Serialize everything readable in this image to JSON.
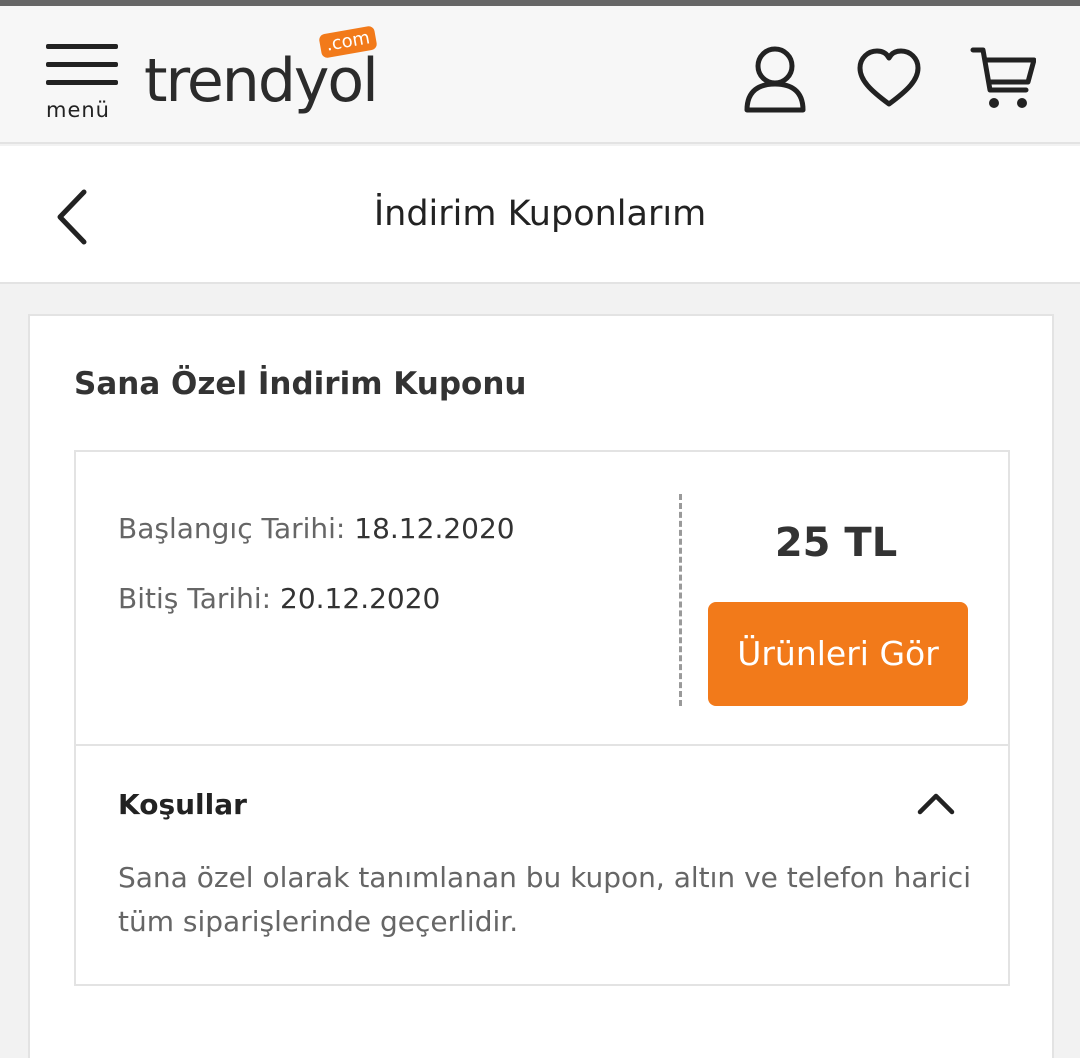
{
  "header": {
    "menu_label": "menü",
    "logo_word": "trendyol",
    "logo_badge": ".com",
    "brand_color": "#f27a1a",
    "icons": [
      "user-icon",
      "heart-icon",
      "cart-icon"
    ]
  },
  "titlebar": {
    "title": "İndirim Kuponlarım",
    "back_icon": "chevron-left-icon"
  },
  "coupon": {
    "heading": "Sana Özel İndirim Kuponu",
    "start_label": "Başlangıç Tarihi:",
    "start_value": "18.12.2020",
    "end_label": "Bitiş Tarihi:",
    "end_value": "20.12.2020",
    "amount": "25 TL",
    "button_label": "Ürünleri Gör",
    "terms_title": "Koşullar",
    "terms_text": "Sana özel olarak tanımlanan bu kupon, altın ve telefon harici tüm siparişlerinde geçerlidir.",
    "terms_icon": "chevron-up-icon"
  }
}
